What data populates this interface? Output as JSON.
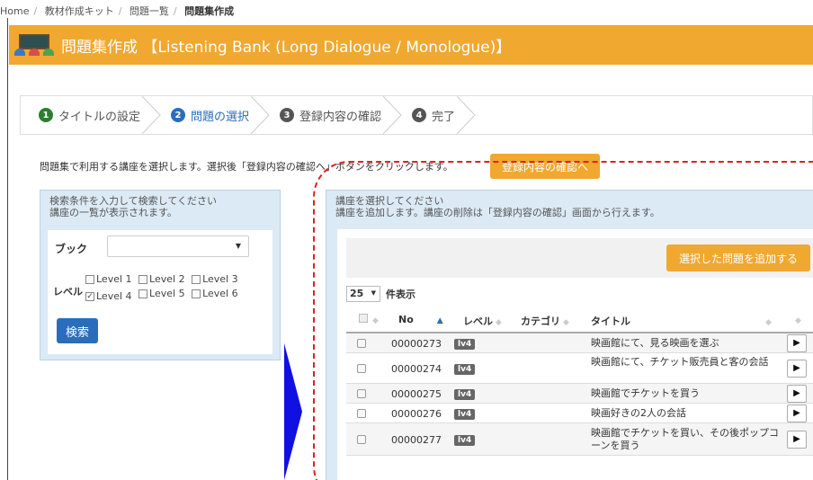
{
  "breadcrumb": {
    "items": [
      "Home",
      "教材作成キット",
      "問題一覧"
    ],
    "current": "問題集作成"
  },
  "header": {
    "title": "問題集作成 【Listening Bank (Long Dialogue / Monologue)】",
    "bg_color": "#f0a830"
  },
  "steps": [
    {
      "num": "1",
      "label": "タイトルの設定",
      "state": "done"
    },
    {
      "num": "2",
      "label": "問題の選択",
      "state": "active"
    },
    {
      "num": "3",
      "label": "登録内容の確認",
      "state": "pending"
    },
    {
      "num": "4",
      "label": "完了",
      "state": "pending"
    }
  ],
  "instruction": "問題集で利用する講座を選択します。選択後「登録内容の確認へ」ボタンをクリックします。",
  "confirm_button": "登録内容の確認へ",
  "search_panel": {
    "heading": "検索条件を入力して検索してください",
    "subheading": "講座の一覧が表示されます。",
    "book_label": "ブック",
    "book_value": "",
    "level_label": "レベル",
    "levels": [
      {
        "label": "Level 1",
        "checked": false
      },
      {
        "label": "Level 2",
        "checked": false
      },
      {
        "label": "Level 3",
        "checked": false
      },
      {
        "label": "Level 4",
        "checked": true
      },
      {
        "label": "Level 5",
        "checked": false
      },
      {
        "label": "Level 6",
        "checked": false
      }
    ],
    "search_button": "検索"
  },
  "course_panel": {
    "heading": "講座を選択してください",
    "subheading": "講座を追加します。講座の削除は「登録内容の確認」画面から行えます。",
    "add_button": "選択した問題を追加する",
    "per_page_value": "25",
    "per_page_label": "件表示",
    "columns": {
      "no": "No",
      "level": "レベル",
      "category": "カテゴリ",
      "title": "タイトル"
    },
    "rows": [
      {
        "no": "00000273",
        "level": "lv4",
        "category": "",
        "title": "映画館にて、見る映画を選ぶ"
      },
      {
        "no": "00000274",
        "level": "lv4",
        "category": "",
        "title": "映画館にて、チケット販売員と客の会話"
      },
      {
        "no": "00000275",
        "level": "lv4",
        "category": "",
        "title": "映画館でチケットを買う"
      },
      {
        "no": "00000276",
        "level": "lv4",
        "category": "",
        "title": "映画好きの2人の会話"
      },
      {
        "no": "00000277",
        "level": "lv4",
        "category": "",
        "title": "映画館でチケットを買い、その後ポップコーンを買う"
      }
    ]
  },
  "colors": {
    "accent_orange": "#f0a830",
    "primary_blue": "#2a6ebb",
    "annotation_red": "#e02020",
    "arrow_blue": "#1010e0"
  }
}
